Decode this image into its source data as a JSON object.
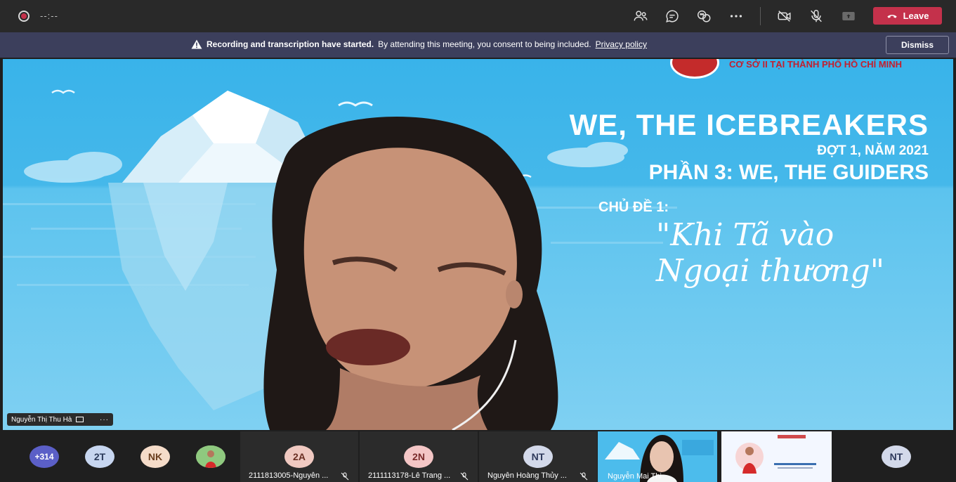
{
  "topbar": {
    "timer": "--:--",
    "leave_label": "Leave",
    "icons": [
      "people-icon",
      "chat-icon",
      "reactions-icon",
      "more-icon",
      "camera-icon",
      "mic-off-icon",
      "share-icon"
    ]
  },
  "banner": {
    "bold_text": "Recording and transcription have started.",
    "text": "By attending this meeting, you consent to being included.",
    "link": "Privacy policy",
    "dismiss_label": "Dismiss"
  },
  "slide": {
    "logo_text": "CƠ SỞ II TẠI THÀNH PHỐ HỒ CHÍ MINH",
    "title": "WE, THE ICEBREAKERS",
    "subtitle": "ĐỢT 1, NĂM 2021",
    "part": "PHẦN 3: WE, THE GUIDERS",
    "topic_label": "CHỦ ĐỀ 1:",
    "topic_quote": "\"Khi Tã vào Ngoại thương\""
  },
  "main_speaker": {
    "name": "Nguyễn Thị Thu Hà"
  },
  "participants": {
    "overflow": "+314",
    "avatars": [
      {
        "initials": "2T",
        "color": "#c7d6f0"
      },
      {
        "initials": "NK",
        "color": "#f5dcc9"
      }
    ],
    "tiles": [
      {
        "initials": "2A",
        "name": "2111813005-Nguyễn ...",
        "color": "#f0c9c1"
      },
      {
        "initials": "2N",
        "name": "2111113178-Lê Trang ...",
        "color": "#f4c6c6"
      },
      {
        "initials": "NT",
        "name": "Nguyễn Hoàng Thủy ...",
        "color": "#d3d9ea"
      }
    ],
    "video_tiles": [
      {
        "name": "Nguyễn Mai Thi"
      }
    ],
    "last_avatar": {
      "initials": "NT",
      "color": "#d3d9ea"
    }
  }
}
